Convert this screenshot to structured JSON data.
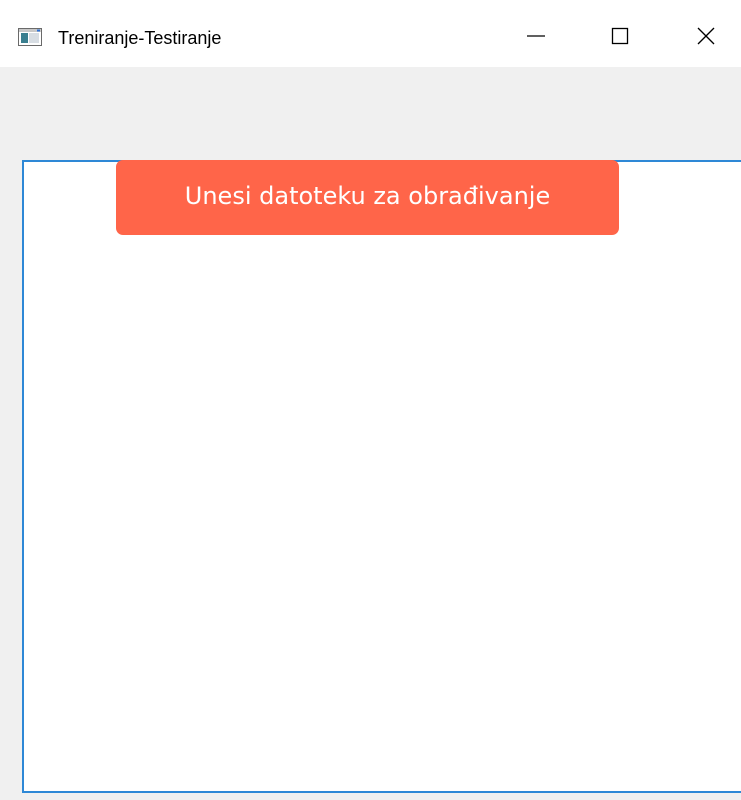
{
  "window": {
    "title": "Treniranje-Testiranje",
    "icon": "app-window-icon",
    "controls": {
      "minimize_icon": "minimize-icon",
      "maximize_icon": "maximize-icon",
      "close_icon": "close-icon"
    }
  },
  "main": {
    "upload_button_label": "Unesi datoteku za obrađivanje"
  },
  "colors": {
    "button_bg": "#ff6549",
    "button_text": "#ffffff",
    "frame_border": "#2e88d6",
    "client_bg": "#f0f0f0"
  }
}
